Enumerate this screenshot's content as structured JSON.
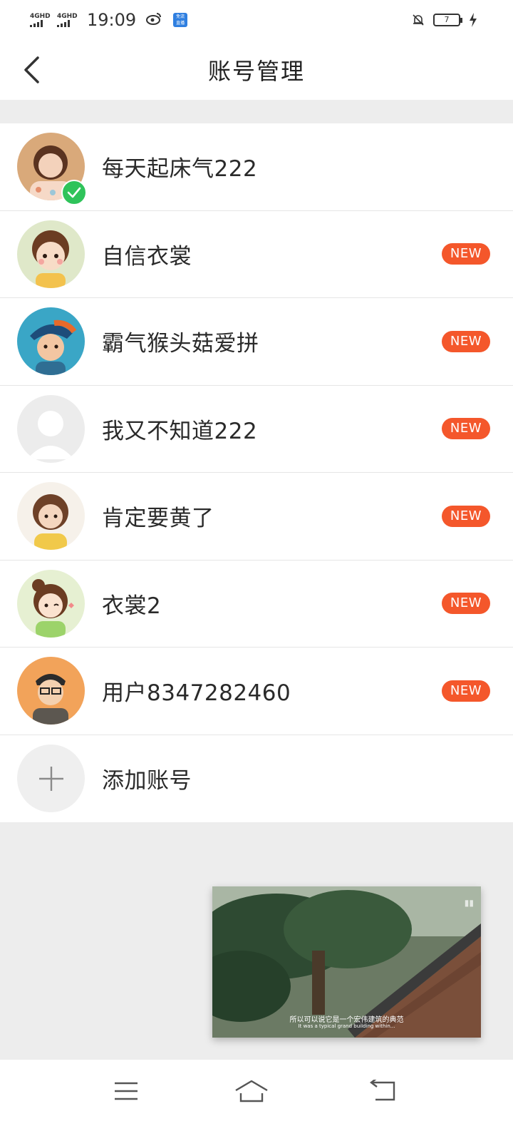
{
  "status_bar": {
    "signal1": "4GHD",
    "signal2": "4GHD",
    "time": "19:09",
    "badge_line1": "免流",
    "badge_line2": "直播",
    "battery_level": "7"
  },
  "header": {
    "title": "账号管理"
  },
  "accounts": [
    {
      "name": "每天起床气222",
      "current": true
    },
    {
      "name": "自信衣裳",
      "badge": "NEW"
    },
    {
      "name": "霸气猴头菇爱拼",
      "badge": "NEW"
    },
    {
      "name": "我又不知道222",
      "badge": "NEW"
    },
    {
      "name": "肯定要黄了",
      "badge": "NEW"
    },
    {
      "name": "衣裳2",
      "badge": "NEW"
    },
    {
      "name": "用户8347282460",
      "badge": "NEW"
    }
  ],
  "add_account": {
    "label": "添加账号"
  },
  "video": {
    "subtitle_cn": "所以可以说它是一个宏伟建筑的典范",
    "subtitle_en": "It was a typical grand building within..."
  },
  "colors": {
    "accent": "#f4572b",
    "check": "#2fc35a",
    "background": "#ededed"
  }
}
